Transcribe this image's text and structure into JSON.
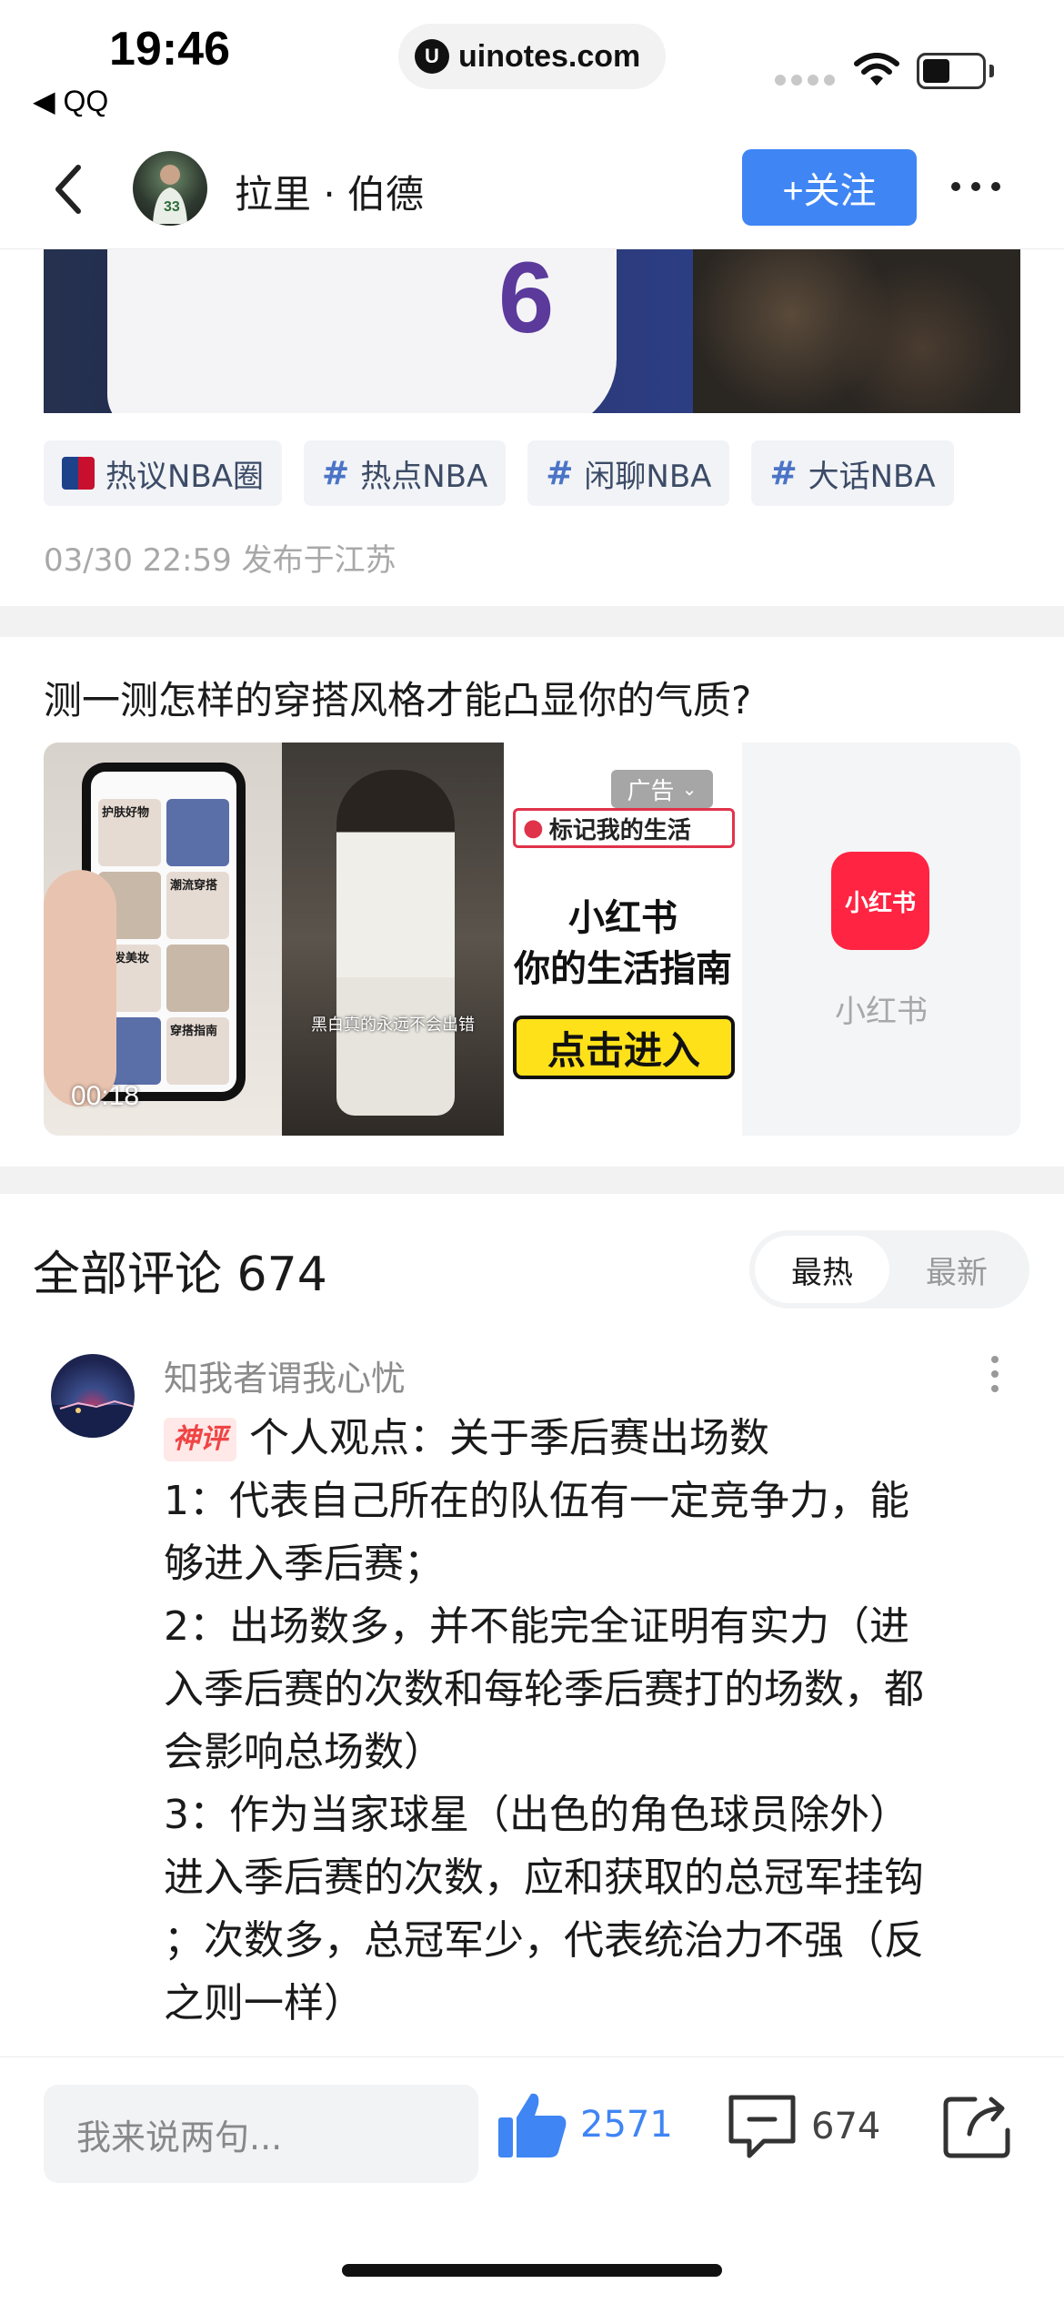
{
  "status_bar": {
    "time": "19:46",
    "back_app": "◀ QQ",
    "url": "uinotes.com"
  },
  "header": {
    "author_name": "拉里 · 伯德",
    "follow_label": "+关注"
  },
  "hero": {
    "jersey_number": "6"
  },
  "tags": [
    {
      "label": "热议NBA圈",
      "icon": "nba-logo-icon"
    },
    {
      "label": "热点NBA",
      "icon": "hash-icon"
    },
    {
      "label": "闲聊NBA",
      "icon": "hash-icon"
    },
    {
      "label": "大话NBA",
      "icon": "hash-icon"
    }
  ],
  "post_meta": "03/30 22:59 发布于江苏",
  "ad": {
    "title": "测一测怎样的穿搭风格才能凸显你的气质?",
    "video_time": "00:18",
    "cell2_caption": "黑白真的永远不会出错",
    "ad_badge": "广告",
    "location_label": "标记我的生活",
    "slogan_line1": "小红书",
    "slogan_line2": "你的生活指南",
    "enter_label": "点击进入",
    "brand_logo_text": "小红书",
    "brand_name": "小红书",
    "phone_tags": [
      "护肤好物",
      "潮流穿搭",
      "美发美妆",
      "穿搭指南"
    ]
  },
  "comments": {
    "title": "全部评论 674",
    "sort_hot": "最热",
    "sort_new": "最新",
    "items": [
      {
        "user": "知我者谓我心忧",
        "badge": "神评",
        "lines": [
          "个人观点：关于季后赛出场数",
          "1：代表自己所在的队伍有一定竞争力，能",
          "够进入季后赛；",
          "2：出场数多，并不能完全证明有实力（进",
          "入季后赛的次数和每轮季后赛打的场数，都",
          "会影响总场数）",
          "3：作为当家球星（出色的角色球员除外）",
          "进入季后赛的次数，应和获取的总冠军挂钩",
          "；次数多，总冠军少，代表统治力不强（反",
          "之则一样）"
        ]
      }
    ]
  },
  "bottom_bar": {
    "input_placeholder": "我来说两句...",
    "like_count": "2571",
    "comment_count": "674"
  },
  "colors": {
    "accent": "#3f85f4",
    "tag_text": "#3c4b66",
    "badge_red": "#f04444",
    "xhs_red": "#ff2442"
  }
}
